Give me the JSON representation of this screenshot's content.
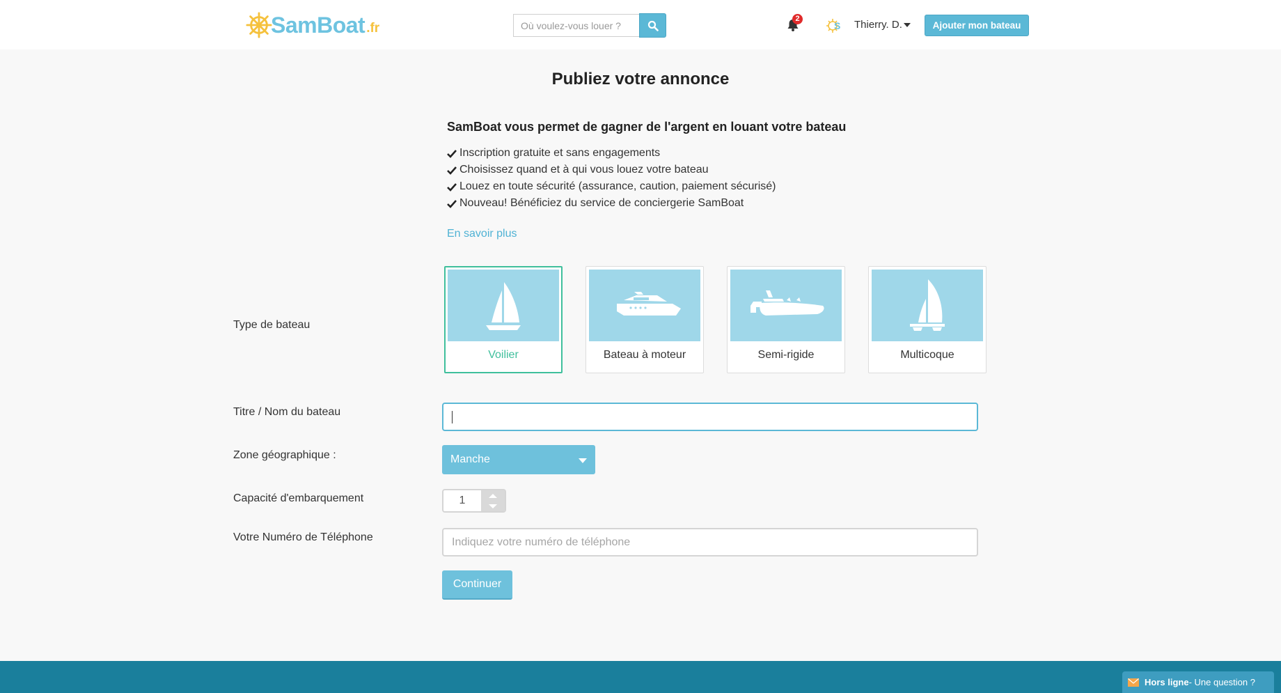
{
  "header": {
    "brand": "SamBoat",
    "tld": ".fr",
    "search_placeholder": "Où voulez-vous louer ?",
    "notifications_count": "2",
    "user_name": "Thierry. D.",
    "add_boat_label": "Ajouter mon bateau"
  },
  "main": {
    "page_title": "Publiez votre annonce",
    "intro_title": "SamBoat vous permet de gagner de l'argent en louant votre bateau",
    "benefits": [
      "Inscription gratuite et sans engagements",
      "Choisissez quand et à qui vous louez votre bateau",
      "Louez en toute sécurité (assurance, caution, paiement sécurisé)",
      "Nouveau! Bénéficiez du service de conciergerie SamBoat"
    ],
    "learn_more": "En savoir plus"
  },
  "form": {
    "boat_type_label": "Type de bateau",
    "boat_types": [
      {
        "label": "Voilier",
        "icon": "sailboat-icon",
        "selected": true
      },
      {
        "label": "Bateau à moteur",
        "icon": "motorboat-icon",
        "selected": false
      },
      {
        "label": "Semi-rigide",
        "icon": "rib-boat-icon",
        "selected": false
      },
      {
        "label": "Multicoque",
        "icon": "catamaran-icon",
        "selected": false
      }
    ],
    "title_label": "Titre / Nom du bateau",
    "title_value": "",
    "zone_label": "Zone géographique :",
    "zone_value": "Manche",
    "capacity_label": "Capacité d'embarquement",
    "capacity_value": "1",
    "phone_label": "Votre Numéro de Téléphone",
    "phone_placeholder": "Indiquez votre numéro de téléphone",
    "continue_label": "Continuer"
  },
  "chat": {
    "status": "Hors ligne",
    "question": " - Une question ?"
  },
  "colors": {
    "accent": "#5bb8d6",
    "selected": "#3fbf9c",
    "footer": "#1a7f9c",
    "card_image_bg": "#9fd7e9"
  }
}
